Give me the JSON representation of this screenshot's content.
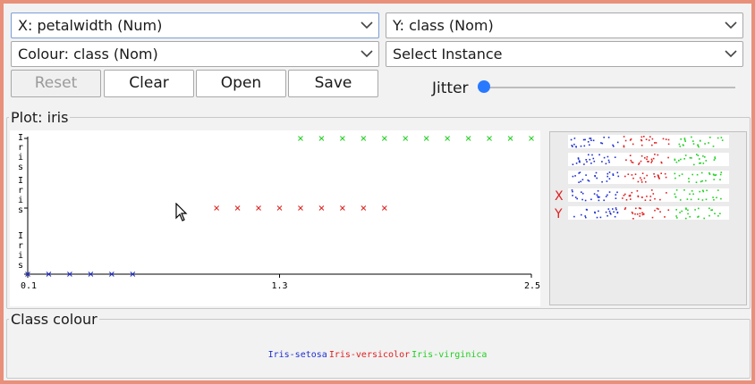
{
  "x_axis_select": {
    "value": "X: petalwidth (Num)"
  },
  "y_axis_select": {
    "value": "Y: class (Nom)"
  },
  "colour_select": {
    "value": "Colour: class (Nom)"
  },
  "instance_select": {
    "value": "Select Instance"
  },
  "buttons": {
    "reset": "Reset",
    "clear": "Clear",
    "open": "Open",
    "save": "Save"
  },
  "jitter": {
    "label": "Jitter",
    "value": 0
  },
  "plot": {
    "title": "Plot: iris"
  },
  "class_colour": {
    "title": "Class colour",
    "classes": [
      {
        "name": "Iris-setosa",
        "color": "#1f2fd0"
      },
      {
        "name": "Iris-versicolor",
        "color": "#e02020"
      },
      {
        "name": "Iris-virginica",
        "color": "#20d020"
      }
    ]
  },
  "attribute_panel": {
    "labels": [
      "X",
      "Y"
    ]
  },
  "chart_data": {
    "type": "scatter",
    "xlabel": "petalwidth",
    "ylabel": "class",
    "xlim": [
      0.1,
      2.5
    ],
    "x_ticks": [
      "0.1",
      "1.3",
      "2.5"
    ],
    "y_categories": [
      "Iris-setosa",
      "Iris-versicolor",
      "Iris-virginica"
    ],
    "y_tick_labels": [
      "Iris",
      "Iris",
      "Iris"
    ],
    "series": [
      {
        "name": "Iris-setosa",
        "color": "#1f2fd0",
        "x": [
          0.1,
          0.2,
          0.3,
          0.4,
          0.5,
          0.6
        ],
        "y": "Iris-setosa"
      },
      {
        "name": "Iris-versicolor",
        "color": "#e02020",
        "x": [
          1.0,
          1.1,
          1.2,
          1.3,
          1.4,
          1.5,
          1.6,
          1.7,
          1.8
        ],
        "y": "Iris-versicolor"
      },
      {
        "name": "Iris-virginica",
        "color": "#20d020",
        "x": [
          1.4,
          1.5,
          1.6,
          1.7,
          1.8,
          1.9,
          2.0,
          2.1,
          2.2,
          2.3,
          2.4,
          2.5
        ],
        "y": "Iris-virginica"
      }
    ]
  }
}
